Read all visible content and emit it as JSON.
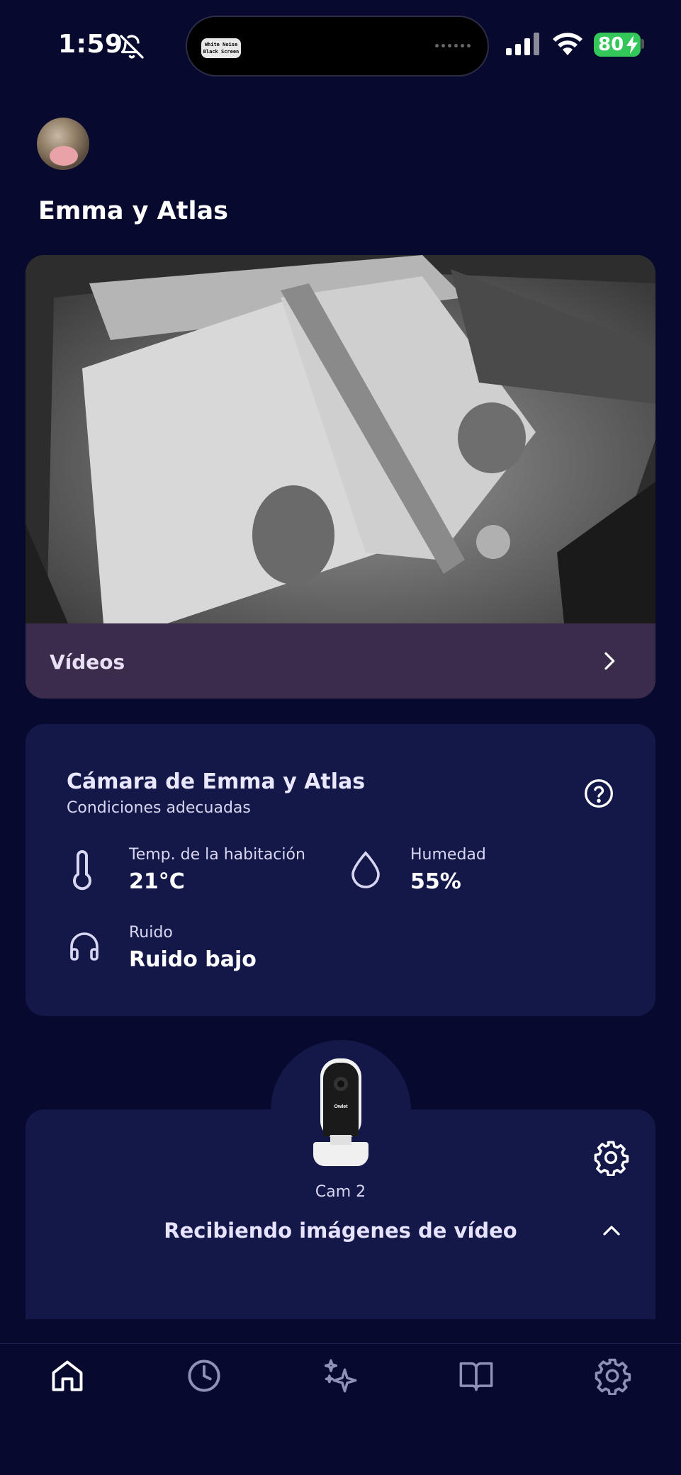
{
  "status_bar": {
    "time": "1:59",
    "battery": "80",
    "island_badge": "White Noise Black Screen"
  },
  "header": {
    "title": "Emma y Atlas"
  },
  "video": {
    "videos_label": "Vídeos"
  },
  "conditions": {
    "title": "Cámara de Emma y Atlas",
    "subtitle": "Condiciones adecuadas",
    "temperature": {
      "label": "Temp. de la habitación",
      "value": "21°C"
    },
    "humidity": {
      "label": "Humedad",
      "value": "55%"
    },
    "noise": {
      "label": "Ruido",
      "value": "Ruido bajo"
    }
  },
  "device": {
    "brand_label": "Owlet",
    "name": "Cam 2",
    "status": "Recibiendo imágenes de vídeo"
  },
  "tabs": [
    "home-icon",
    "history-icon",
    "sparkles-icon",
    "book-icon",
    "settings-icon"
  ],
  "colors": {
    "background": "#070a2e",
    "card": "#141848",
    "videos_bar": "#3a2c4a",
    "battery": "#33c759"
  }
}
